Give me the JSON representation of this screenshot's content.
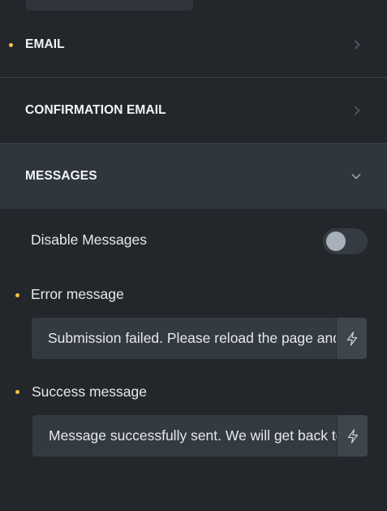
{
  "sections": {
    "email": {
      "label": "EMAIL",
      "modified": true
    },
    "confirmation_email": {
      "label": "CONFIRMATION EMAIL"
    },
    "messages": {
      "label": "MESSAGES",
      "expanded": true
    }
  },
  "messages": {
    "disable_label": "Disable Messages",
    "disable_on": false,
    "error": {
      "label": "Error message",
      "value": "Submission failed. Please reload the page and try again."
    },
    "success": {
      "label": "Success message",
      "value": "Message successfully sent. We will get back to you as soon as possible."
    }
  },
  "icons": {
    "chevron_right": "chevron-right-icon",
    "chevron_down": "chevron-down-icon",
    "dynamic_data": "lightning-bolt-icon"
  },
  "colors": {
    "background": "#23272b",
    "expanded_header": "#2f363d",
    "modified_dot": "#f3c33c",
    "input_bg": "#333a41"
  }
}
